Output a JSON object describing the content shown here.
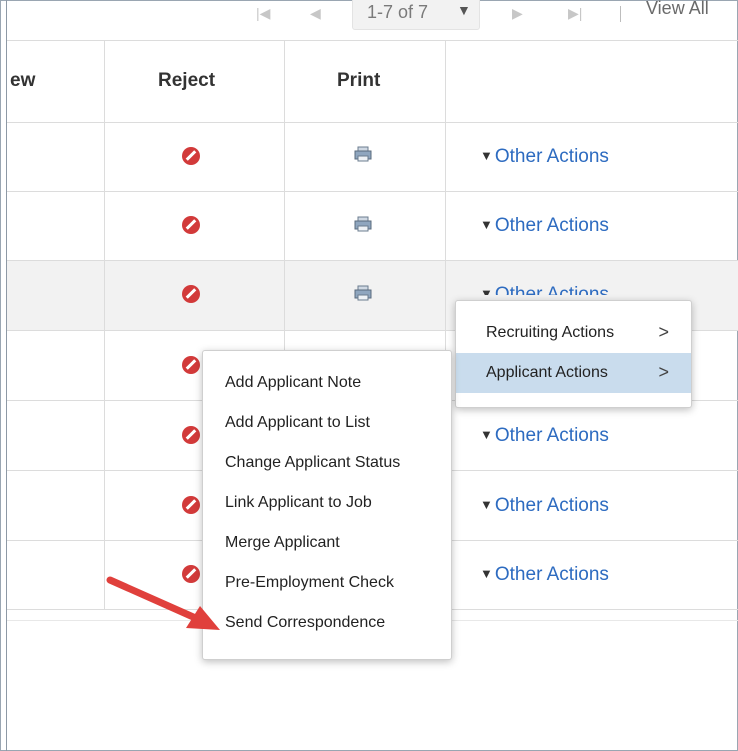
{
  "pager": {
    "range_text": "1-7 of 7",
    "view_all": "View All"
  },
  "table": {
    "columns": [
      "ew",
      "Reject",
      "Print",
      ""
    ],
    "rows": [
      {
        "action": "Other Actions"
      },
      {
        "action": "Other Actions"
      },
      {
        "action": "Other Actions"
      },
      {
        "action": ""
      },
      {
        "action": "Other Actions"
      },
      {
        "action": "Other Actions"
      },
      {
        "action": "Other Actions"
      }
    ]
  },
  "actions_menu": {
    "items": [
      {
        "label": "Recruiting Actions"
      },
      {
        "label": "Applicant Actions"
      }
    ]
  },
  "applicant_submenu": {
    "items": [
      "Add Applicant Note",
      "Add Applicant to List",
      "Change Applicant Status",
      "Link Applicant to Job",
      "Merge Applicant",
      "Pre-Employment Check",
      "Send Correspondence"
    ]
  },
  "colors": {
    "link": "#2d6bc0",
    "reject": "#d23a3a",
    "highlight": "#c9dced",
    "arrow": "#e0403c"
  },
  "icons": [
    "first-page-icon",
    "prev-page-icon",
    "dropdown-caret-icon",
    "next-page-icon",
    "last-page-icon",
    "reject-icon",
    "print-icon",
    "triangle-down-icon",
    "chevron-right-icon",
    "red-arrow"
  ]
}
